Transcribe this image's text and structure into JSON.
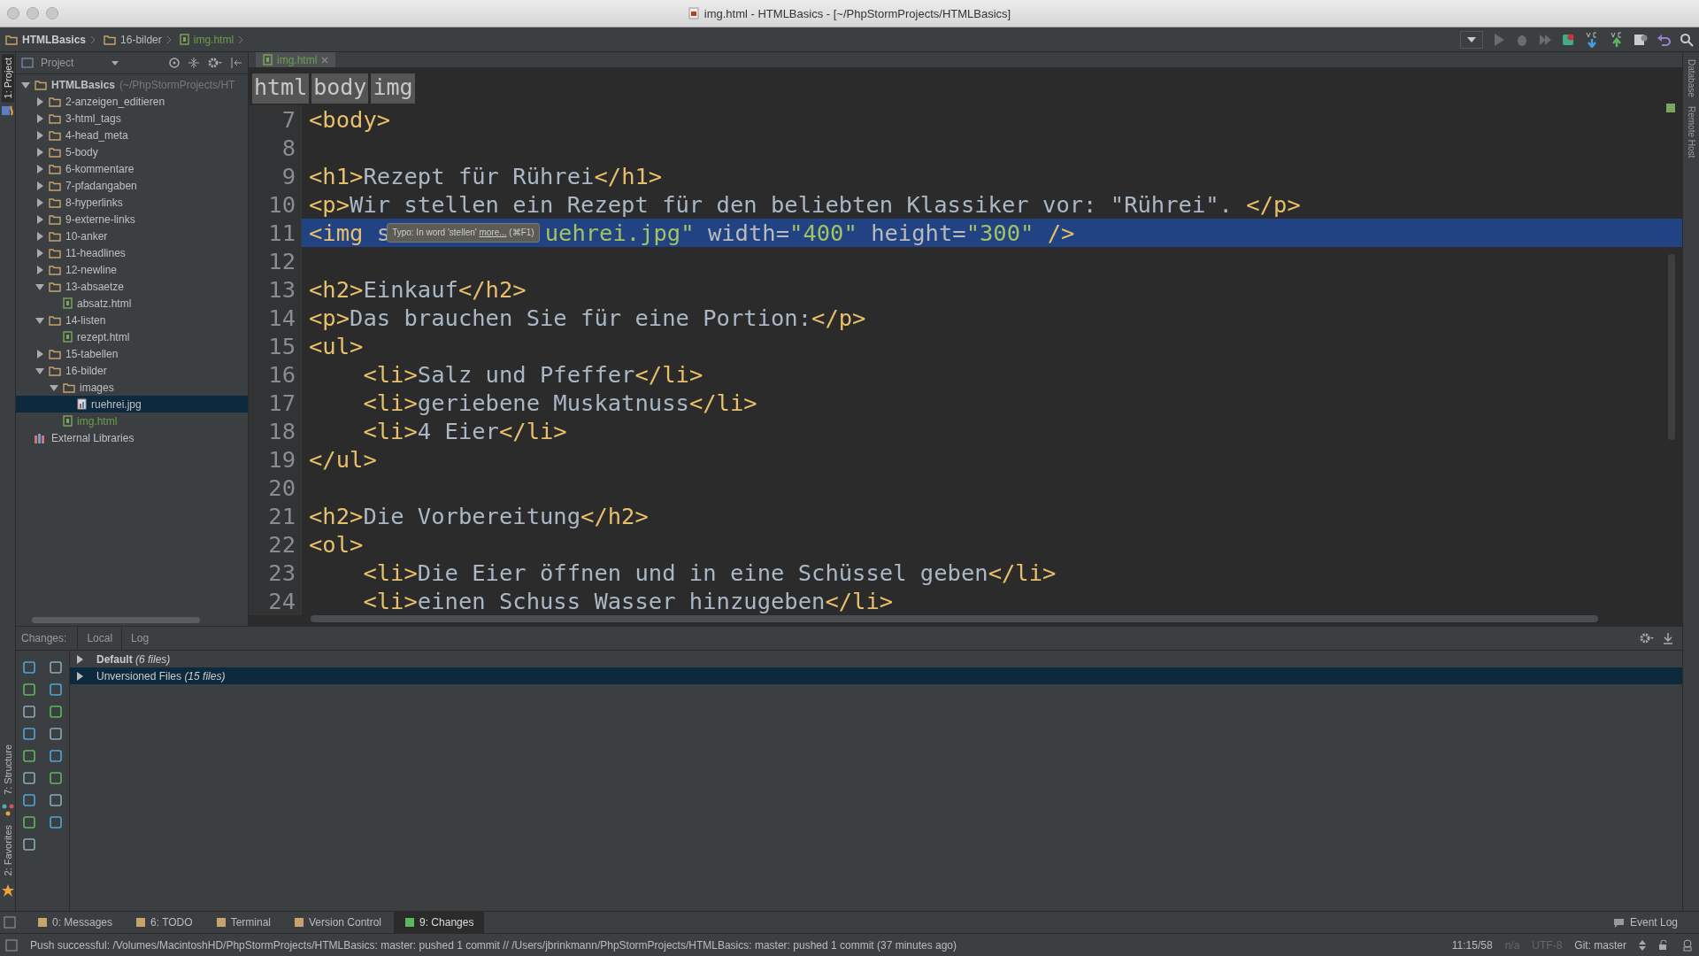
{
  "window": {
    "title": "img.html - HTMLBasics - [~/PhpStormProjects/HTMLBasics]"
  },
  "navbar": {
    "crumbs": [
      {
        "label": "HTMLBasics",
        "kind": "project"
      },
      {
        "label": "16-bilder",
        "kind": "folder"
      },
      {
        "label": "img.html",
        "kind": "file"
      }
    ]
  },
  "left_strip": [
    {
      "label": "1: Project",
      "selected": true
    },
    {
      "label": "7: Structure",
      "selected": false
    },
    {
      "label": "2: Favorites",
      "selected": false
    }
  ],
  "right_strip": [
    {
      "label": "Database"
    },
    {
      "label": "Remote Host"
    }
  ],
  "project_panel": {
    "title": "Project",
    "tree": [
      {
        "label": "HTMLBasics",
        "hint": "(~/PhpStormProjects/HT",
        "kind": "folder",
        "expanded": true,
        "selected": false,
        "added": false,
        "children": [
          {
            "label": "2-anzeigen_editieren",
            "kind": "folder",
            "expanded": false,
            "selected": false,
            "added": false
          },
          {
            "label": "3-html_tags",
            "kind": "folder",
            "expanded": false,
            "selected": false,
            "added": false
          },
          {
            "label": "4-head_meta",
            "kind": "folder",
            "expanded": false,
            "selected": false,
            "added": false
          },
          {
            "label": "5-body",
            "kind": "folder",
            "expanded": false,
            "selected": false,
            "added": false
          },
          {
            "label": "6-kommentare",
            "kind": "folder",
            "expanded": false,
            "selected": false,
            "added": false
          },
          {
            "label": "7-pfadangaben",
            "kind": "folder",
            "expanded": false,
            "selected": false,
            "added": false
          },
          {
            "label": "8-hyperlinks",
            "kind": "folder",
            "expanded": false,
            "selected": false,
            "added": false
          },
          {
            "label": "9-externe-links",
            "kind": "folder",
            "expanded": false,
            "selected": false,
            "added": false
          },
          {
            "label": "10-anker",
            "kind": "folder",
            "expanded": false,
            "selected": false,
            "added": false
          },
          {
            "label": "11-headlines",
            "kind": "folder",
            "expanded": false,
            "selected": false,
            "added": false
          },
          {
            "label": "12-newline",
            "kind": "folder",
            "expanded": false,
            "selected": false,
            "added": false
          },
          {
            "label": "13-absaetze",
            "kind": "folder",
            "expanded": true,
            "selected": false,
            "added": false,
            "children": [
              {
                "label": "absatz.html",
                "kind": "html",
                "selected": false,
                "added": false
              }
            ]
          },
          {
            "label": "14-listen",
            "kind": "folder",
            "expanded": true,
            "selected": false,
            "added": false,
            "children": [
              {
                "label": "rezept.html",
                "kind": "html",
                "selected": false,
                "added": false
              }
            ]
          },
          {
            "label": "15-tabellen",
            "kind": "folder",
            "expanded": false,
            "selected": false,
            "added": false
          },
          {
            "label": "16-bilder",
            "kind": "folder",
            "expanded": true,
            "selected": false,
            "added": false,
            "children": [
              {
                "label": "images",
                "kind": "folder",
                "expanded": true,
                "selected": false,
                "added": false,
                "children": [
                  {
                    "label": "ruehrei.jpg",
                    "kind": "image",
                    "selected": true,
                    "added": false
                  }
                ]
              },
              {
                "label": "img.html",
                "kind": "html",
                "selected": false,
                "added": true
              }
            ]
          }
        ]
      },
      {
        "label": "External Libraries",
        "kind": "library",
        "selected": false,
        "added": false
      }
    ]
  },
  "editor": {
    "tabs": [
      {
        "label": "img.html",
        "selected": true
      }
    ],
    "breadcrumbs": [
      "html",
      "body",
      "img"
    ],
    "lines": [
      {
        "number": "7",
        "selected": false,
        "segments": [
          {
            "kind": "code",
            "tokens": [
              {
                "kind": "tag",
                "text": "<body>"
              }
            ]
          }
        ]
      },
      {
        "number": "8",
        "selected": false
      },
      {
        "number": "9",
        "selected": false,
        "segments": [
          {
            "kind": "code",
            "tokens": [
              {
                "kind": "tag",
                "text": "<h1>"
              },
              {
                "kind": "text",
                "text": "Rezept für Rührei"
              },
              {
                "kind": "tag",
                "text": "</h1>"
              }
            ]
          }
        ]
      },
      {
        "number": "10",
        "selected": false,
        "segments": [
          {
            "kind": "code",
            "tokens": [
              {
                "kind": "tag",
                "text": "<p>"
              },
              {
                "kind": "text",
                "text": "Wir stellen ein Rezept für den beliebten Klassiker vor: \"Rührei\". "
              },
              {
                "kind": "tag",
                "text": "</p>"
              }
            ]
          }
        ]
      },
      {
        "number": "11",
        "selected": true,
        "segments": [
          {
            "kind": "code",
            "tokens": [
              {
                "kind": "tag",
                "text": "<img "
              },
              {
                "kind": "attr",
                "text": "s"
              }
            ]
          },
          {
            "kind": "tooltip",
            "text": "Typo: In word 'stellen' ",
            "link": "more...",
            "shortcut": " (⌘F1)"
          },
          {
            "kind": "code",
            "tokens": [
              {
                "kind": "value",
                "text": "uehrei.jpg\""
              },
              {
                "kind": "attr",
                "text": " width="
              },
              {
                "kind": "value",
                "text": "\"400\""
              },
              {
                "kind": "attr",
                "text": " height="
              },
              {
                "kind": "value",
                "text": "\"300\""
              },
              {
                "kind": "tag",
                "text": " />"
              }
            ]
          }
        ]
      },
      {
        "number": "12",
        "selected": false
      },
      {
        "number": "13",
        "selected": false,
        "segments": [
          {
            "kind": "code",
            "tokens": [
              {
                "kind": "tag",
                "text": "<h2>"
              },
              {
                "kind": "text",
                "text": "Einkauf"
              },
              {
                "kind": "tag",
                "text": "</h2>"
              }
            ]
          }
        ]
      },
      {
        "number": "14",
        "selected": false,
        "segments": [
          {
            "kind": "code",
            "tokens": [
              {
                "kind": "tag",
                "text": "<p>"
              },
              {
                "kind": "text",
                "text": "Das brauchen Sie für eine Portion:"
              },
              {
                "kind": "tag",
                "text": "</p>"
              }
            ]
          }
        ]
      },
      {
        "number": "15",
        "selected": false,
        "segments": [
          {
            "kind": "code",
            "tokens": [
              {
                "kind": "tag",
                "text": "<ul>"
              }
            ]
          }
        ]
      },
      {
        "number": "16",
        "selected": false,
        "segments": [
          {
            "kind": "code",
            "tokens": [
              {
                "kind": "tag",
                "text": "    <li>"
              },
              {
                "kind": "text",
                "text": "Salz und Pfeffer"
              },
              {
                "kind": "tag",
                "text": "</li>"
              }
            ]
          }
        ]
      },
      {
        "number": "17",
        "selected": false,
        "segments": [
          {
            "kind": "code",
            "tokens": [
              {
                "kind": "tag",
                "text": "    <li>"
              },
              {
                "kind": "text",
                "text": "geriebene Muskatnuss"
              },
              {
                "kind": "tag",
                "text": "</li>"
              }
            ]
          }
        ]
      },
      {
        "number": "18",
        "selected": false,
        "segments": [
          {
            "kind": "code",
            "tokens": [
              {
                "kind": "tag",
                "text": "    <li>"
              },
              {
                "kind": "text",
                "text": "4 Eier"
              },
              {
                "kind": "tag",
                "text": "</li>"
              }
            ]
          }
        ]
      },
      {
        "number": "19",
        "selected": false,
        "segments": [
          {
            "kind": "code",
            "tokens": [
              {
                "kind": "tag",
                "text": "</ul>"
              }
            ]
          }
        ]
      },
      {
        "number": "20",
        "selected": false
      },
      {
        "number": "21",
        "selected": false,
        "segments": [
          {
            "kind": "code",
            "tokens": [
              {
                "kind": "tag",
                "text": "<h2>"
              },
              {
                "kind": "text",
                "text": "Die Vorbereitung"
              },
              {
                "kind": "tag",
                "text": "</h2>"
              }
            ]
          }
        ]
      },
      {
        "number": "22",
        "selected": false,
        "segments": [
          {
            "kind": "code",
            "tokens": [
              {
                "kind": "tag",
                "text": "<ol>"
              }
            ]
          }
        ]
      },
      {
        "number": "23",
        "selected": false,
        "segments": [
          {
            "kind": "code",
            "tokens": [
              {
                "kind": "tag",
                "text": "    <li>"
              },
              {
                "kind": "text",
                "text": "Die Eier öffnen und in eine Schüssel geben"
              },
              {
                "kind": "tag",
                "text": "</li>"
              }
            ]
          }
        ]
      },
      {
        "number": "24",
        "selected": false,
        "segments": [
          {
            "kind": "code",
            "tokens": [
              {
                "kind": "tag",
                "text": "    <li>"
              },
              {
                "kind": "text",
                "text": "einen Schuss Wasser hinzugeben"
              },
              {
                "kind": "tag",
                "text": "</li>"
              }
            ]
          }
        ]
      }
    ]
  },
  "changes_panel": {
    "title": "Changes:",
    "tabs": [
      {
        "label": "Local",
        "selected": false
      },
      {
        "label": "Log",
        "selected": false
      }
    ],
    "groups": [
      {
        "label": "**Default** *(6 files)*",
        "selected": false
      },
      {
        "label": "Unversioned Files *(15 files)*",
        "selected": true
      }
    ]
  },
  "tool_tabs": [
    {
      "label": "0: Messages",
      "selected": false
    },
    {
      "label": "6: TODO",
      "selected": false
    },
    {
      "label": "Terminal",
      "selected": false
    },
    {
      "label": "Version Control",
      "selected": false
    },
    {
      "label": "9: Changes",
      "selected": true
    }
  ],
  "event_log": "Event Log",
  "status_bar": {
    "message": "Push successful: /Volumes/MacintoshHD/PhpStormProjects/HTMLBasics: master: pushed 1 commit // /Users/jbrinkmann/PhpStormProjects/HTMLBasics: master: pushed 1 commit (37 minutes ago)",
    "position": "11:15/58",
    "line_sep": "n/a",
    "encoding": "UTF-8",
    "branch": "Git: master"
  }
}
